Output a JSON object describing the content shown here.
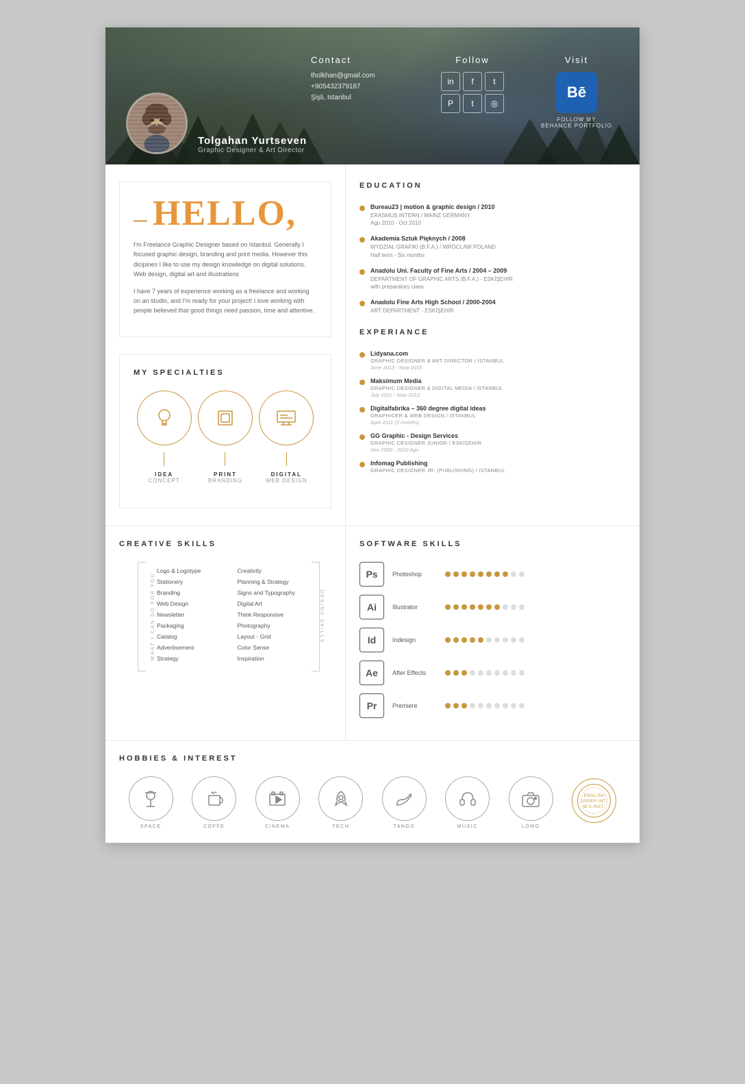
{
  "header": {
    "name": "Tolgahan Yurtseven",
    "title": "Graphic Designer & Art Director",
    "contact": {
      "label": "Contact",
      "email": "tholkhan@gmail.com",
      "phone": "+905432379187",
      "address": "Şişli, Istanbul"
    },
    "follow": {
      "label": "Follow",
      "icons": [
        "in",
        "f",
        "t",
        "℗",
        "t",
        "📷"
      ]
    },
    "visit": {
      "label": "Visit",
      "behance_text": "Bē",
      "follow_label": "FOLLOW MY",
      "portfolio_label": "BEHANCE PORTFOLIO"
    }
  },
  "hello": {
    "dash": "—",
    "title": "HELLO,",
    "paragraph1": "I'm Freelance Graphic Designer based on Istanbul. Generally I focused graphic design, branding and print media. However this dicipines I like to use my design knowledge on digital solutions. Web design, digital art and illustrations",
    "paragraph2": "I have 7 years of experience working as a freelance and working on an studio, and I'm ready for your project! I love working with people believed that good things need passion, time and attentive."
  },
  "specialties": {
    "title": "MY SPECIALTIES",
    "items": [
      {
        "icon": "💡",
        "label": "IDEA",
        "sublabel": "CONCEPT"
      },
      {
        "icon": "🖨",
        "label": "PRINT",
        "sublabel": "BRANDING"
      },
      {
        "icon": "🖥",
        "label": "DIGITAL",
        "sublabel": "WEB DESIGN"
      }
    ]
  },
  "education": {
    "title": "EDUCATION",
    "items": [
      {
        "school": "Bureau23 | motion & graphic design / 2010",
        "detail": "ERASMUS INTERN / MAINZ GERMANY",
        "date": "Agu 2010 - Oct 2010"
      },
      {
        "school": "Akademia Sztuk Pięknych / 2008",
        "detail": "WYDZIAŁ GRAFIKI (B.F.A.) / WROCLAW POLAND",
        "date": "Half term - Six months"
      },
      {
        "school": "Anadolu Uni. Faculty of Fine Arts / 2004 – 2009",
        "detail": "DEPARTMENT OF GRAPHIC ARTS (B.F.A.) - ESKİŞEHİR",
        "date": "with preparatory class"
      },
      {
        "school": "Anadolu Fine Arts High School / 2000-2004",
        "detail": "ART DEPARTMENT - ESKİŞEHİR",
        "date": ""
      }
    ]
  },
  "experience": {
    "title": "EXPERIANCE",
    "items": [
      {
        "company": "Lidyana.com",
        "role": "GRAPHIC DESIGNER & ART DIRECTOR / ISTANBUL",
        "date": "June 2013 - Now 2015"
      },
      {
        "company": "Maksimum Media",
        "role": "GRAPHIC DESIGNER & DIGITAL MEDIA / ISTANBUL",
        "date": "July 2011 - Now 2012"
      },
      {
        "company": "Digitalfabrika – 360 degree digital ideas",
        "role": "GRAPHICER & WEB DESIGN / ISTANBUL",
        "date": "April 2011 (3 months)"
      },
      {
        "company": "GG Graphic - Design Services",
        "role": "GRAPHIC DESIGNER JUNIOR / ESKİŞEHİR",
        "date": "Dec 2009 - 2010 Agu"
      },
      {
        "company": "Infomag Publishing",
        "role": "GRAPHIC DESIGNER JR. (PUBLISHING) / ISTANBUL",
        "date": ""
      }
    ]
  },
  "creative_skills": {
    "title": "CREATIVE SKILLS",
    "left_label": "WHAT I CAN DO FOR YOU",
    "right_label": "DESING SKILLS",
    "col1": [
      "Logo & Logotype",
      "Stationery",
      "Branding",
      "Web Design",
      "Newsletter",
      "Packaging",
      "Catalog",
      "Advertisement",
      "Strategy"
    ],
    "col2": [
      "Creativity",
      "Planning & Strategy",
      "Signs and Typography",
      "Digital Art",
      "Think Responsive",
      "Photography",
      "Layout - Grid",
      "Color Sense",
      "Inspiration"
    ]
  },
  "software_skills": {
    "title": "SOFTWARE SKILLS",
    "items": [
      {
        "name": "Photoshop",
        "abbr": "Ps",
        "filled": 8,
        "empty": 2
      },
      {
        "name": "Illustrator",
        "abbr": "Ai",
        "filled": 7,
        "empty": 3
      },
      {
        "name": "Indesign",
        "abbr": "Id",
        "filled": 5,
        "empty": 5
      },
      {
        "name": "After Effects",
        "abbr": "Ae",
        "filled": 3,
        "empty": 7
      },
      {
        "name": "Premiere",
        "abbr": "Pr",
        "filled": 3,
        "empty": 7
      }
    ]
  },
  "hobbies": {
    "title": "HOBBIES & INTEREST",
    "items": [
      {
        "icon": "🔭",
        "label": "SPACE"
      },
      {
        "icon": "☕",
        "label": "COFFE"
      },
      {
        "icon": "🎬",
        "label": "CINEMA"
      },
      {
        "icon": "🚀",
        "label": "TECH"
      },
      {
        "icon": "💃",
        "label": "TANGO"
      },
      {
        "icon": "🎧",
        "label": "MUSIC"
      },
      {
        "icon": "📷",
        "label": "LOMO"
      },
      {
        "icon": "◎",
        "label": "ENGLISH\nUPPER INT.\nW.S.INST."
      }
    ]
  }
}
